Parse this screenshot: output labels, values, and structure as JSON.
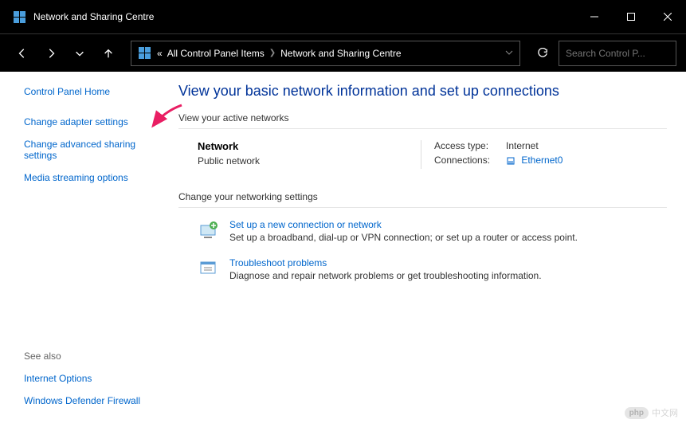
{
  "window": {
    "title": "Network and Sharing Centre"
  },
  "breadcrumb": {
    "prefix": "«",
    "items": [
      "All Control Panel Items",
      "Network and Sharing Centre"
    ]
  },
  "search": {
    "placeholder": "Search Control P..."
  },
  "sidebar": {
    "home": "Control Panel Home",
    "links": [
      "Change adapter settings",
      "Change advanced sharing settings",
      "Media streaming options"
    ],
    "see_also_label": "See also",
    "see_also": [
      "Internet Options",
      "Windows Defender Firewall"
    ]
  },
  "main": {
    "title": "View your basic network information and set up connections",
    "active_networks_header": "View your active networks",
    "network": {
      "name": "Network",
      "type": "Public network",
      "access_label": "Access type:",
      "access_value": "Internet",
      "connections_label": "Connections:",
      "connections_value": "Ethernet0"
    },
    "settings_header": "Change your networking settings",
    "settings": [
      {
        "link": "Set up a new connection or network",
        "desc": "Set up a broadband, dial-up or VPN connection; or set up a router or access point."
      },
      {
        "link": "Troubleshoot problems",
        "desc": "Diagnose and repair network problems or get troubleshooting information."
      }
    ]
  },
  "watermark": {
    "logo": "php",
    "text": "中文网"
  }
}
